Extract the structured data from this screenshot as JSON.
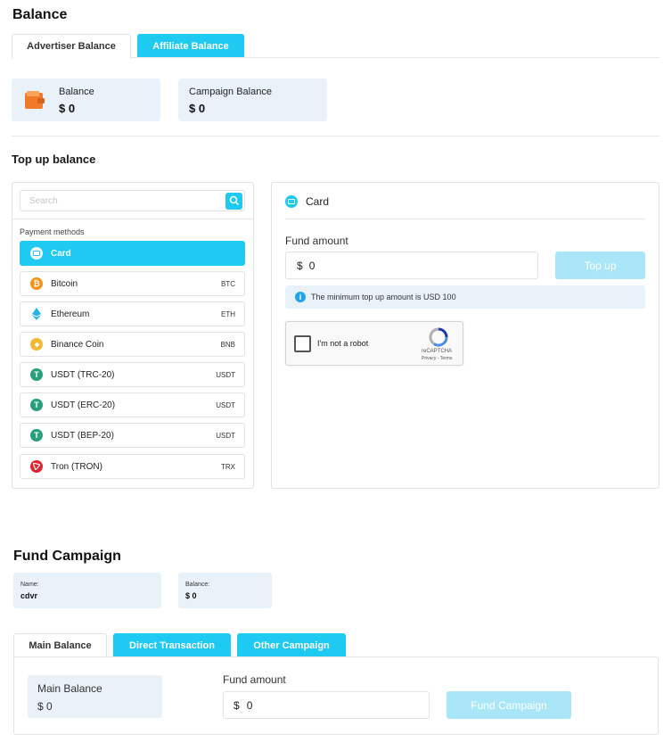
{
  "balance": {
    "title": "Balance",
    "tabs": [
      {
        "label": "Advertiser Balance"
      },
      {
        "label": "Affiliate Balance"
      }
    ],
    "cards": [
      {
        "label": "Balance",
        "value": "$ 0"
      },
      {
        "label": "Campaign Balance",
        "value": "$ 0"
      }
    ]
  },
  "topup": {
    "title": "Top up balance",
    "search_placeholder": "Search",
    "methods_label": "Payment methods",
    "methods": [
      {
        "name": "Card",
        "code": ""
      },
      {
        "name": "Bitcoin",
        "code": "BTC"
      },
      {
        "name": "Ethereum",
        "code": "ETH"
      },
      {
        "name": "Binance Coin",
        "code": "BNB"
      },
      {
        "name": "USDT (TRC-20)",
        "code": "USDT"
      },
      {
        "name": "USDT (ERC-20)",
        "code": "USDT"
      },
      {
        "name": "USDT (BEP-20)",
        "code": "USDT"
      },
      {
        "name": "Tron (TRON)",
        "code": "TRX"
      }
    ],
    "panel_title": "Card",
    "fund_label": "Fund amount",
    "currency": "$",
    "fund_value": "0",
    "topup_button": "Top up",
    "info": "The minimum top up amount is USD 100",
    "captcha": {
      "label": "I'm not a robot",
      "brand": "reCAPTCHA",
      "links": "Privacy - Terms"
    }
  },
  "fund_campaign": {
    "title": "Fund Campaign",
    "name_label": "Name:",
    "name_value": "cdvr",
    "balance_label": "Balance:",
    "balance_value": "$ 0",
    "tabs": [
      {
        "label": "Main Balance"
      },
      {
        "label": "Direct Transaction"
      },
      {
        "label": "Other Campaign"
      }
    ],
    "main_balance_label": "Main Balance",
    "main_balance_value": "$ 0",
    "fund_label": "Fund amount",
    "currency": "$",
    "fund_value": "0",
    "fund_button": "Fund Campaign"
  },
  "colors": {
    "accent": "#1ec9f2",
    "accent_disabled": "#a8e6f8",
    "card_bg": "#e9f2f9"
  }
}
